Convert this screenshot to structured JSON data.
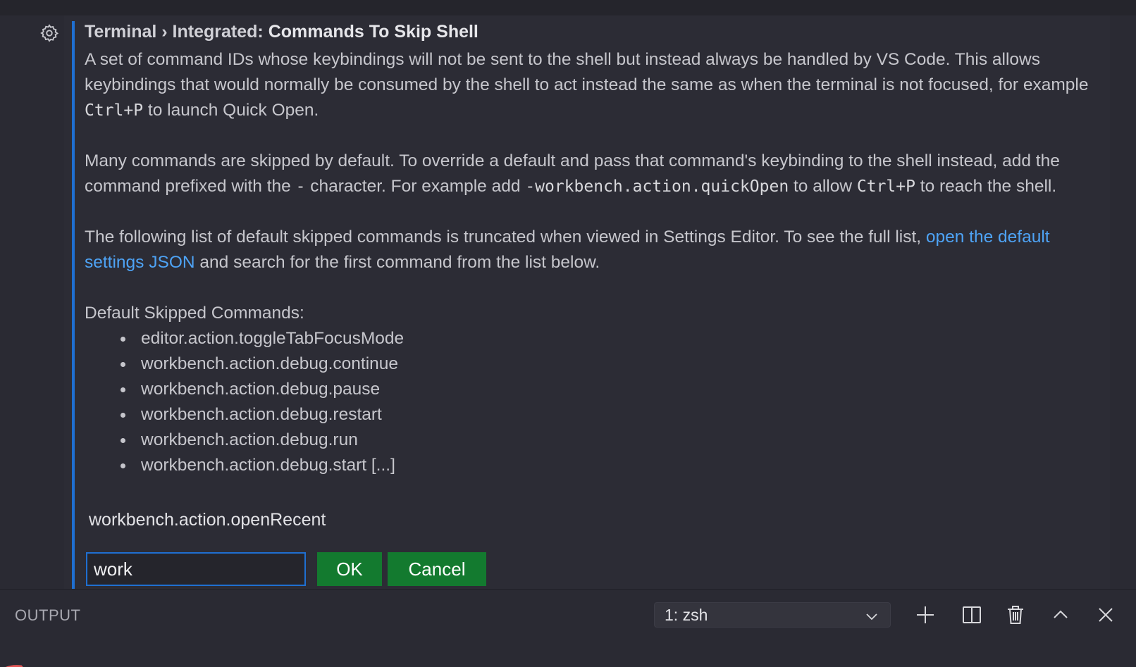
{
  "setting": {
    "title_category": "Terminal › Integrated: ",
    "title_name": "Commands To Skip Shell",
    "p1_text_a": "A set of command IDs whose keybindings will not be sent to the shell but instead always be handled by VS Code. This allows keybindings that would normally be consumed by the shell to act instead the same as when the terminal is not focused, for example ",
    "p1_code": "Ctrl+P",
    "p1_text_b": " to launch Quick Open.",
    "p2_text_a": "Many commands are skipped by default. To override a default and pass that command's keybinding to the shell instead, add the command prefixed with the ",
    "p2_code_dash": "-",
    "p2_text_b": " character. For example add ",
    "p2_code_example": "-workbench.action.quickOpen",
    "p2_text_c": " to allow ",
    "p2_code_ctrlp": "Ctrl+P",
    "p2_text_d": " to reach the shell.",
    "p3_text_a": "The following list of default skipped commands is truncated when viewed in Settings Editor. To see the full list, ",
    "p3_link": "open the default settings JSON",
    "p3_text_b": " and search for the first command from the list below.",
    "skipped_heading": "Default Skipped Commands:",
    "skipped_items": [
      "editor.action.toggleTabFocusMode",
      "workbench.action.debug.continue",
      "workbench.action.debug.pause",
      "workbench.action.debug.restart",
      "workbench.action.debug.run",
      "workbench.action.debug.start [...]"
    ],
    "existing_item": "workbench.action.openRecent",
    "input_value": "work",
    "ok_label": "OK",
    "cancel_label": "Cancel"
  },
  "panel": {
    "title": "OUTPUT",
    "terminal_selected": "1: zsh"
  },
  "icons": {
    "gear": "gear-icon",
    "chevron": "chevron-down-icon",
    "add": "plus-icon",
    "split": "split-terminal-icon",
    "trash": "trash-icon",
    "maximize": "chevron-up-icon",
    "close": "close-icon"
  },
  "colors": {
    "accent": "#1f6fd1",
    "link": "#4ea3f5",
    "button": "#137a2f"
  }
}
